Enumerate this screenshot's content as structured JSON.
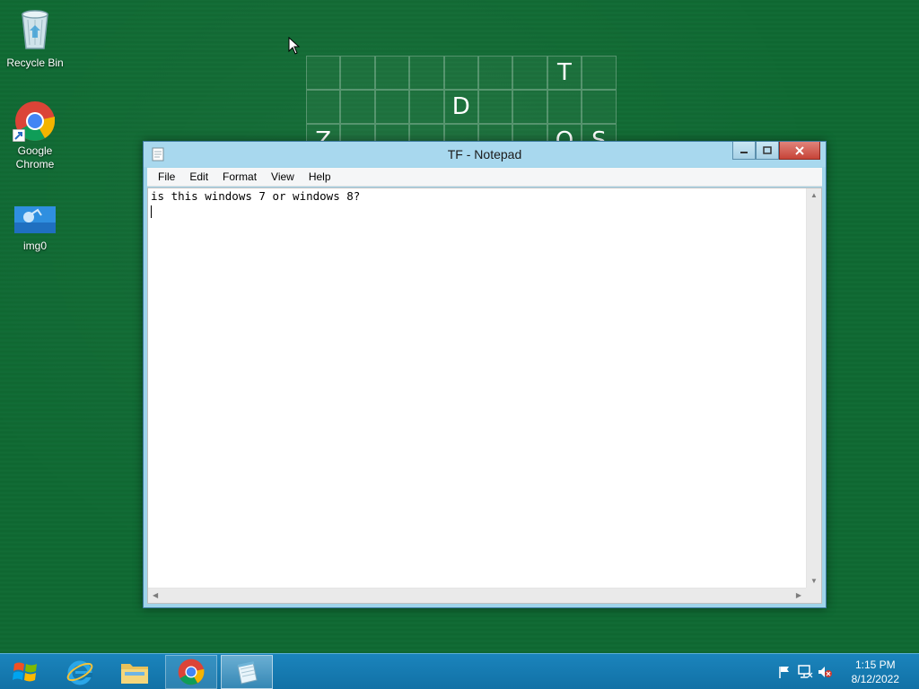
{
  "desktop": {
    "icons": [
      {
        "label": "Recycle Bin",
        "icon": "recycle-bin-icon"
      },
      {
        "label": "Google Chrome",
        "icon": "chrome-icon"
      },
      {
        "label": "img0",
        "icon": "image-file-icon"
      }
    ],
    "puzzle": {
      "rows": [
        [
          "",
          "",
          "",
          "",
          "",
          "",
          "",
          "T",
          ""
        ],
        [
          "",
          "",
          "",
          "",
          "D",
          "",
          "",
          "",
          ""
        ],
        [
          "Z",
          "",
          "",
          "",
          "",
          "",
          "",
          "O",
          "S"
        ]
      ]
    }
  },
  "notepad": {
    "title": "TF - Notepad",
    "menu": [
      "File",
      "Edit",
      "Format",
      "View",
      "Help"
    ],
    "content": "is this windows 7 or windows 8?"
  },
  "taskbar": {
    "apps": [
      "internet-explorer-icon",
      "file-explorer-icon",
      "chrome-icon",
      "notepad-icon"
    ],
    "time": "1:15 PM",
    "date": "8/12/2022"
  },
  "colors": {
    "desktop_bg": "#0f6a33",
    "taskbar": "#1171a6",
    "window_frame": "#9fd4ea",
    "close_button": "#c74438"
  }
}
